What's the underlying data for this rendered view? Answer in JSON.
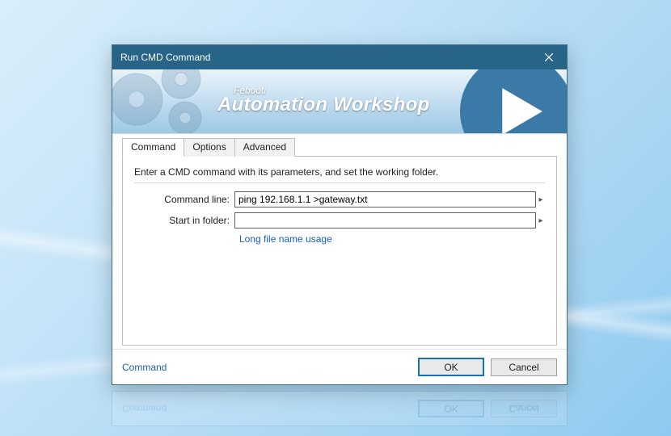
{
  "window": {
    "title": "Run CMD Command"
  },
  "banner": {
    "brand_small": "Febooti",
    "brand_big": "Automation Workshop"
  },
  "tabs": [
    {
      "label": "Command",
      "active": true
    },
    {
      "label": "Options",
      "active": false
    },
    {
      "label": "Advanced",
      "active": false
    }
  ],
  "form": {
    "instruction": "Enter a CMD command with its parameters, and set the working folder.",
    "command_line_label": "Command line:",
    "command_line_value": "ping 192.168.1.1 >gateway.txt",
    "start_in_label": "Start in folder:",
    "start_in_value": "",
    "help_link": "Long file name usage"
  },
  "footer": {
    "breadcrumb": "Command",
    "ok": "OK",
    "cancel": "Cancel"
  }
}
